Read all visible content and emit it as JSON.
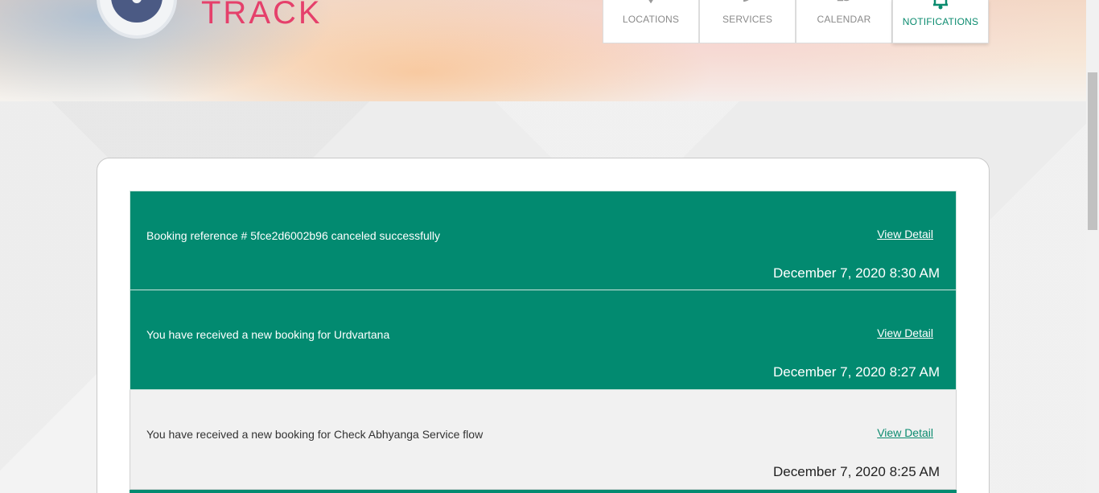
{
  "brand": {
    "logo_text": "TRACK"
  },
  "nav": {
    "items": [
      {
        "label": "LOCATIONS",
        "icon": "location-pin-icon"
      },
      {
        "label": "SERVICES",
        "icon": "services-icon"
      },
      {
        "label": "CALENDAR",
        "icon": "calendar-clock-icon"
      },
      {
        "label": "NOTIFICATIONS",
        "icon": "bell-icon",
        "active": true
      }
    ]
  },
  "notifications": [
    {
      "message": "Booking reference # 5fce2d6002b96 canceled successfully",
      "action": "View Detail",
      "time": "December 7, 2020 8:30 AM",
      "state": "unread"
    },
    {
      "message": "You have received a new booking for Urdvartana",
      "action": "View Detail",
      "time": "December 7, 2020 8:27 AM",
      "state": "unread"
    },
    {
      "message": "You have received a new booking for Check Abhyanga Service flow",
      "action": "View Detail",
      "time": "December 7, 2020 8:25 AM",
      "state": "read"
    }
  ],
  "colors": {
    "accent": "#028a70",
    "brand_pink": "#e5406b",
    "read_bg": "#f1f1f1"
  }
}
